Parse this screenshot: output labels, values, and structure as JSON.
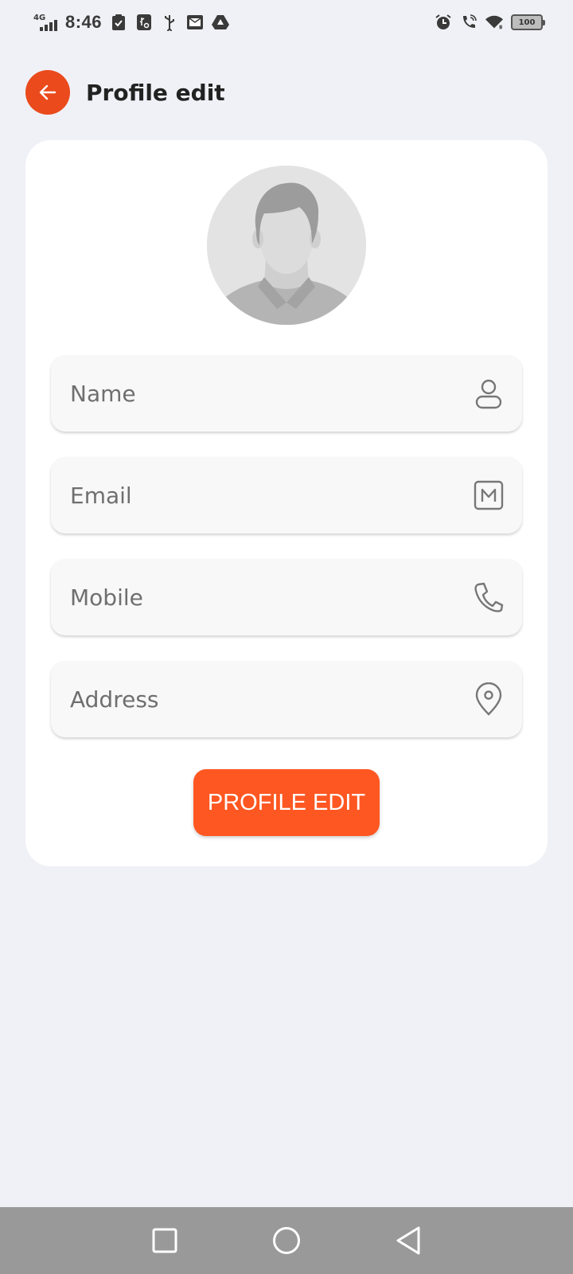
{
  "status_bar": {
    "network": "4G",
    "time": "8:46",
    "battery": "100"
  },
  "header": {
    "title": "Profile edit",
    "back_icon": "arrow-left-icon"
  },
  "form": {
    "name_placeholder": "Name",
    "email_placeholder": "Email",
    "mobile_placeholder": "Mobile",
    "address_placeholder": "Address",
    "submit_label": "PROFILE EDIT"
  },
  "icons": {
    "name": "person-icon",
    "email": "mail-icon",
    "mobile": "phone-icon",
    "address": "location-pin-icon"
  },
  "colors": {
    "accent": "#ff5722",
    "back_button": "#ea4a1c",
    "background": "#f0f1f6"
  }
}
